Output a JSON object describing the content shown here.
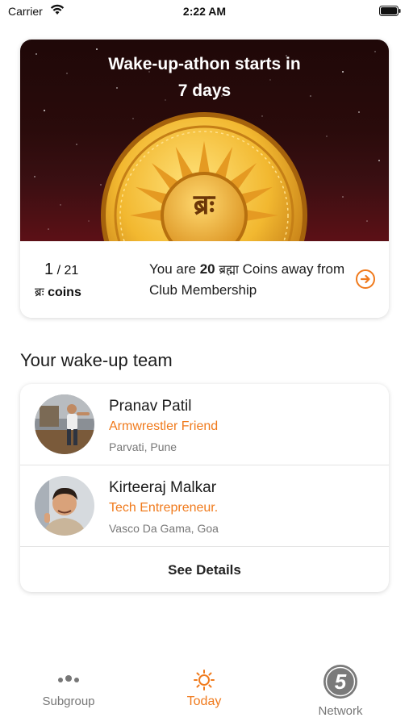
{
  "status_bar": {
    "carrier": "Carrier",
    "time": "2:22 AM"
  },
  "hero": {
    "title_line1": "Wake-up-athon starts in",
    "title_line2": "7 days",
    "coin_symbol": "ब्रः",
    "coins_current": "1",
    "coins_separator": " / ",
    "coins_total": "21",
    "coins_symbol": "ब्रः",
    "coins_label": "coins",
    "away_prefix": "You are ",
    "away_count": "20",
    "away_word": "ब्रह्मा",
    "away_suffix": " Coins away from Club Membership"
  },
  "team": {
    "section_title": "Your wake-up team",
    "members": [
      {
        "name": "Pranav Patil",
        "role": "Armwrestler Friend",
        "location": "Parvati, Pune"
      },
      {
        "name": "Kirteeraj Malkar",
        "role": "Tech Entrepreneur.",
        "location": "Vasco Da Gama, Goa"
      }
    ],
    "see_details": "See Details"
  },
  "nav": {
    "items": [
      {
        "label": "Subgroup",
        "icon": "group-icon"
      },
      {
        "label": "Today",
        "icon": "sun-icon",
        "active": true
      },
      {
        "label": "Network",
        "icon": "network-5-icon",
        "badge": "5"
      }
    ]
  },
  "colors": {
    "accent": "#f07a1c",
    "hero_bg": "#2a0b0b",
    "coin_gold": "#f2b830"
  }
}
